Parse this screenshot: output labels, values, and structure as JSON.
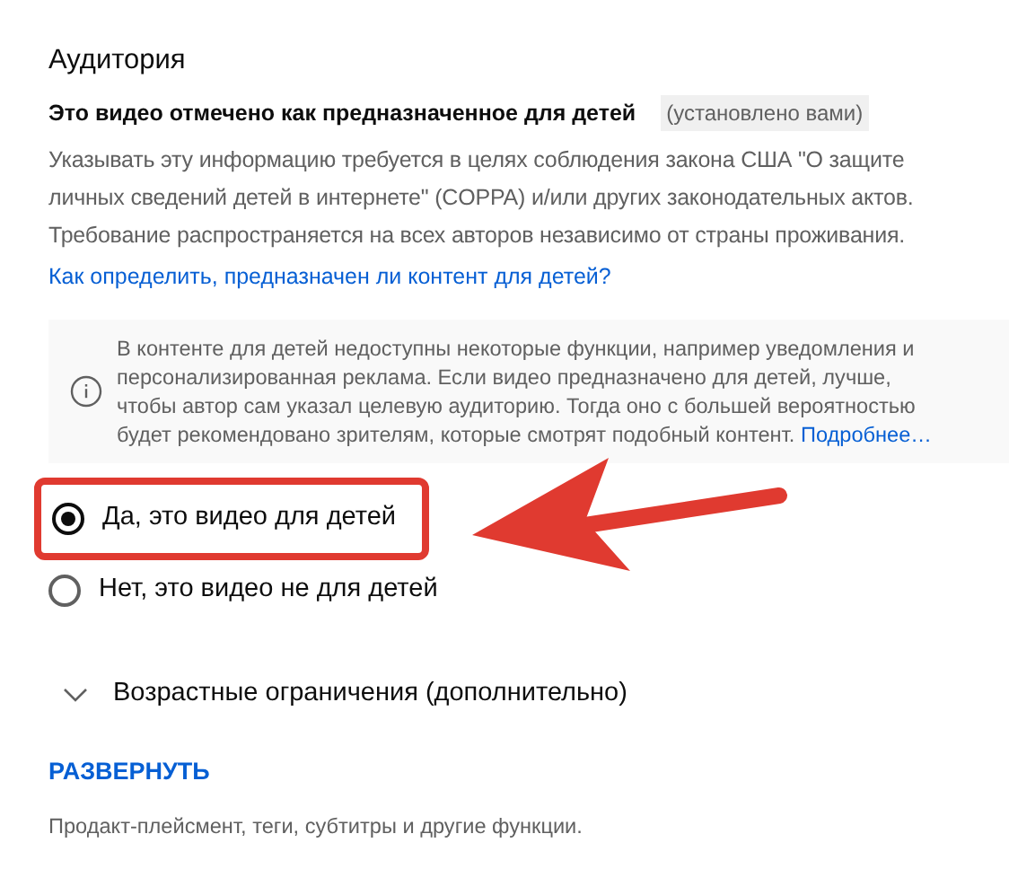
{
  "section": {
    "title": "Аудитория",
    "status": {
      "label": "Это видео отмечено как предназначенное для детей",
      "tag": "(установлено вами)"
    },
    "description": "Указывать эту информацию требуется в целях соблюдения закона США \"О защите личных сведений детей в интернете\" (COPPA) и/или других законодательных актов. Требование распространяется на всех авторов независимо от страны проживания.",
    "help_link": "Как определить, предназначен ли контент для детей?",
    "info": {
      "text": "В контенте для детей недоступны некоторые функции, например уведомления и персонализированная реклама. Если видео предназначено для детей, лучше, чтобы автор сам указал целевую аудиторию. Тогда оно с большей вероятностью будет рекомендовано зрителям, которые смотрят подобный контент.",
      "link": "Подробнее…"
    },
    "options": [
      {
        "label": "Да, это видео для детей",
        "selected": true,
        "highlighted": true
      },
      {
        "label": "Нет, это видео не для детей",
        "selected": false,
        "highlighted": false
      }
    ],
    "age_restrictions": {
      "label": "Возрастные ограничения (дополнительно)",
      "expanded": false
    }
  },
  "expand_button": "РАЗВЕРНУТЬ",
  "footer": "Продакт-плейсмент, теги, субтитры и другие функции."
}
